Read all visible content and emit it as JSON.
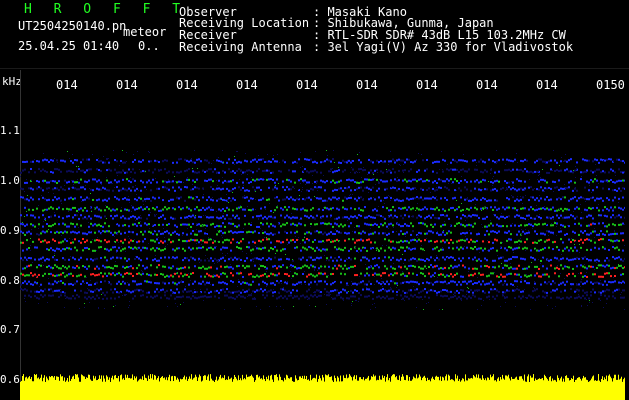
{
  "header": {
    "app": "H R O F F T",
    "file": "UT2504250140.pn",
    "mode": "meteor",
    "datetime": "25.04.25 01:40",
    "extra": "0..",
    "fields": [
      {
        "label": "Observer",
        "value": ": Masaki Kano"
      },
      {
        "label": "Receiving Location",
        "value": ": Shibukawa, Gunma, Japan"
      },
      {
        "label": "Receiver",
        "value": ": RTL-SDR SDR# 43dB L15 103.2MHz CW"
      },
      {
        "label": "Receiving Antenna",
        "value": ": 3el Yagi(V) Az 330 for Vladivostok"
      }
    ]
  },
  "axis": {
    "unit": "kHz",
    "yticks": [
      "1.1",
      "1.0",
      "0.9",
      "0.8",
      "0.7",
      "0.6"
    ],
    "xticks": [
      "014",
      "014",
      "014",
      "014",
      "014",
      "014",
      "014",
      "014",
      "014",
      "0150"
    ]
  },
  "colors": {
    "background": "#000000",
    "noise_dark": "#0b0b5a",
    "noise": "#1a2bff",
    "mid": "#18c018",
    "strong": "#ff2020",
    "baseline": "#ffff00"
  }
}
